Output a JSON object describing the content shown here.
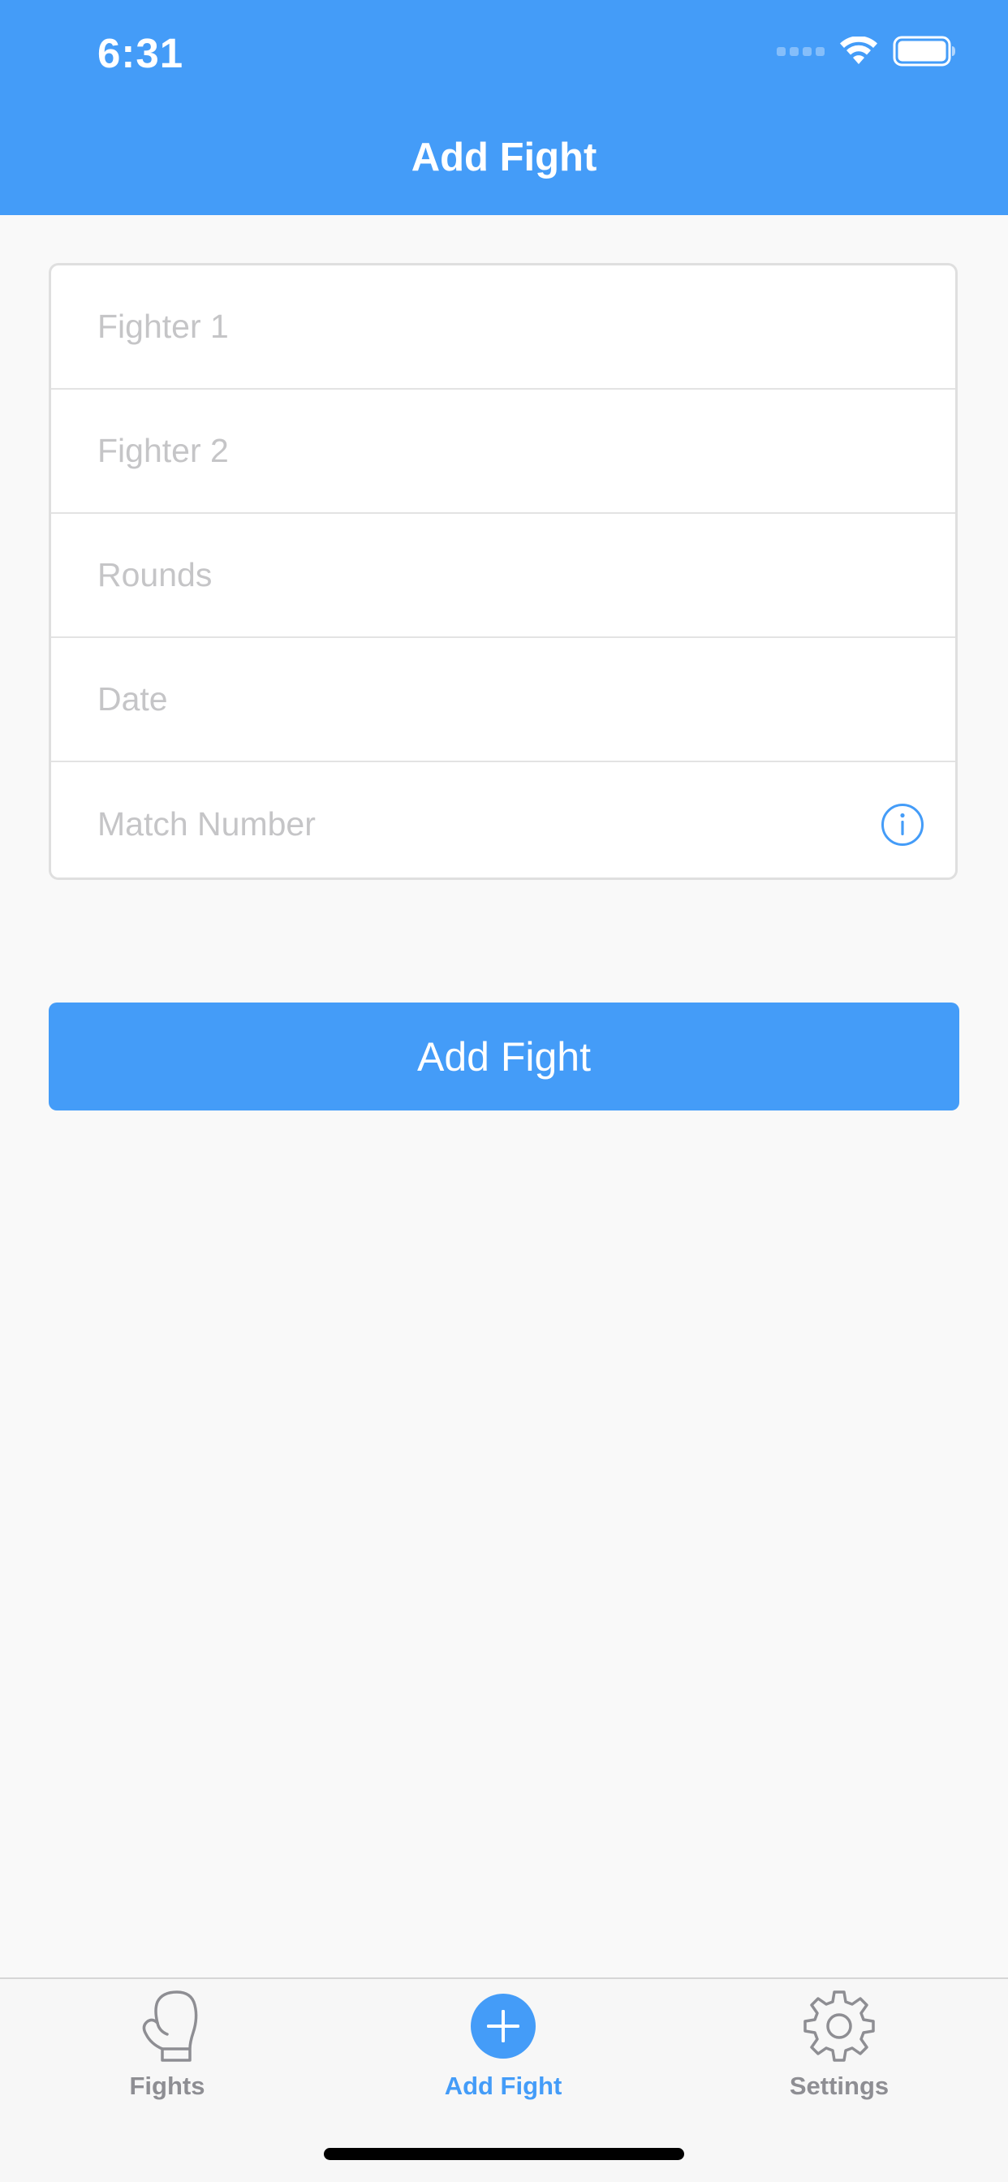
{
  "status_bar": {
    "time": "6:31",
    "wifi_icon": "wifi-icon",
    "battery_icon": "battery-icon"
  },
  "nav": {
    "title": "Add Fight"
  },
  "form": {
    "fields": [
      {
        "placeholder": "Fighter 1",
        "value": ""
      },
      {
        "placeholder": "Fighter 2",
        "value": ""
      },
      {
        "placeholder": "Rounds",
        "value": ""
      },
      {
        "placeholder": "Date",
        "value": ""
      },
      {
        "placeholder": "Match Number",
        "value": "",
        "icon": "info-icon"
      }
    ]
  },
  "submit_button": {
    "label": "Add Fight"
  },
  "tab_bar": {
    "items": [
      {
        "label": "Fights",
        "icon": "boxing-glove-icon",
        "active": false
      },
      {
        "label": "Add Fight",
        "icon": "plus-circle-icon",
        "active": true
      },
      {
        "label": "Settings",
        "icon": "gear-icon",
        "active": false
      }
    ]
  },
  "colors": {
    "accent": "#449cf8",
    "background": "#f9f9f9",
    "placeholder": "#c5c5c7",
    "tab_inactive": "#8e8e93"
  }
}
